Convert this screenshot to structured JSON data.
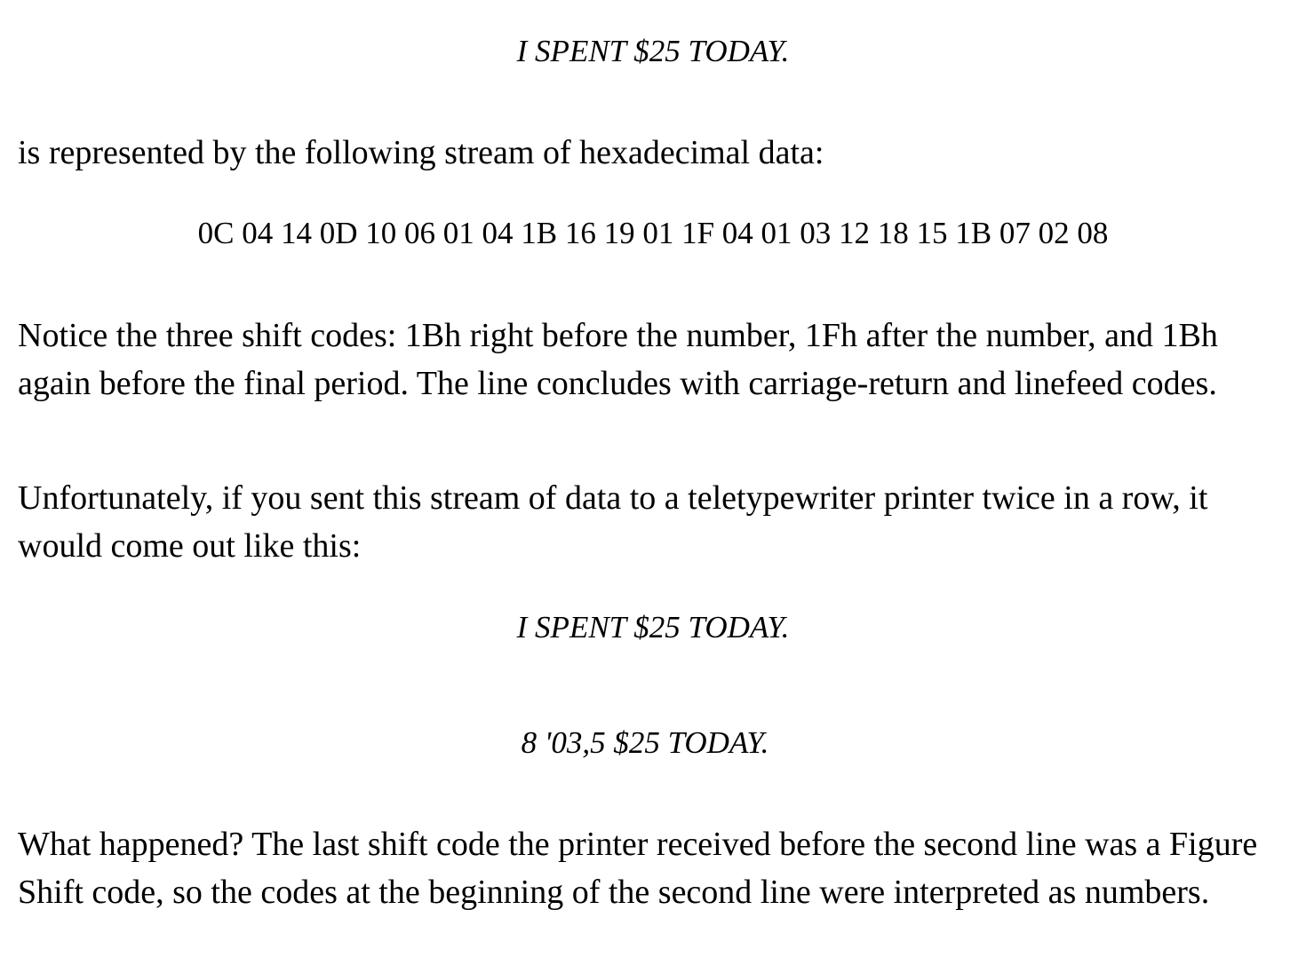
{
  "document": {
    "example_line_1": "I SPENT $25 TODAY.",
    "intro_text": "is represented by the following stream of hexadecimal data:",
    "hex_stream": "0C 04 14 0D 10 06 01 04 1B 16 19 01 1F 04 01 03 12 18 15 1B 07 02 08",
    "shift_notice": "Notice the three shift codes: 1Bh right before the number, 1Fh after the number, and 1Bh again before the final period. The line concludes with carriage-return and linefeed codes.",
    "unfortunately_text": "Unfortunately, if you sent this stream of data to a teletypewriter printer twice in a row, it would come out like this:",
    "printed_line_1": "I SPENT $25 TODAY.",
    "printed_line_2": "8 '03,5 $25 TODAY.",
    "explanation_text": "What happened? The last shift code the printer received before the second line was a Figure Shift code, so the codes at the beginning of the second line were interpreted as numbers."
  }
}
